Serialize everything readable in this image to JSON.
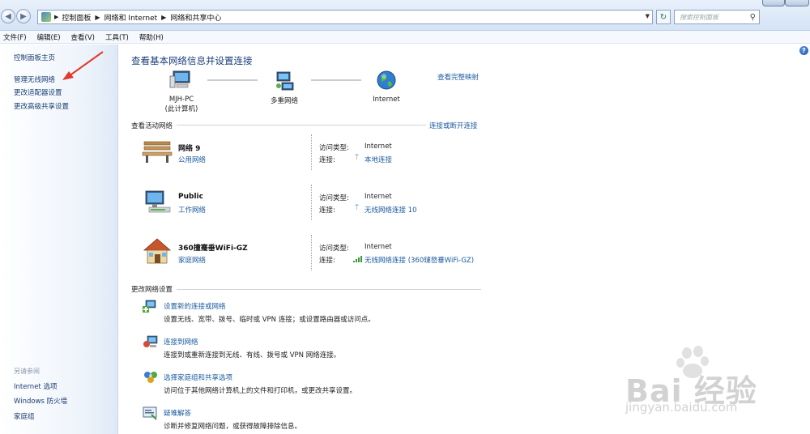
{
  "window": {
    "breadcrumb": [
      "控制面板",
      "网络和 Internet",
      "网络和共享中心"
    ],
    "search_placeholder": "搜索控制面板"
  },
  "menu": [
    "文件(F)",
    "编辑(E)",
    "查看(V)",
    "工具(T)",
    "帮助(H)"
  ],
  "sidebar": {
    "home": "控制面板主页",
    "links": [
      "管理无线网络",
      "更改适配器设置",
      "更改高级共享设置"
    ],
    "see_also_title": "另请参阅",
    "see_also": [
      "Internet 选项",
      "Windows 防火墙",
      "家庭组"
    ]
  },
  "main": {
    "title": "查看基本网络信息并设置连接",
    "full_map": "查看完整映射",
    "nodes": [
      {
        "name": "MJH-PC",
        "sub": "(此计算机)",
        "icon": "computer-icon"
      },
      {
        "name": "多重网络",
        "sub": "",
        "icon": "network-icon"
      },
      {
        "name": "Internet",
        "sub": "",
        "icon": "globe-icon"
      }
    ],
    "active_header": "查看活动网络",
    "connect_link": "连接或断开连接",
    "networks": [
      {
        "name": "网络  9",
        "type": "公用网络",
        "access_label": "访问类型:",
        "access": "Internet",
        "conn_label": "连接:",
        "conn": "本地连接",
        "icon": "bench-icon"
      },
      {
        "name": "Public",
        "type": "工作网络",
        "access_label": "访问类型:",
        "access": "Internet",
        "conn_label": "连接:",
        "conn": "无线网络连接 10",
        "icon": "office-icon"
      },
      {
        "name": "360撞蹇垂WiFi-GZ",
        "type": "家庭网络",
        "access_label": "访问类型:",
        "access": "Internet",
        "conn_label": "连接:",
        "conn": "无线网络连接 (360鏈嶅垂WiFi-GZ)",
        "icon": "house-icon"
      }
    ],
    "change_header": "更改网络设置",
    "tasks": [
      {
        "title": "设置新的连接或网络",
        "desc": "设置无线、宽带、拨号、临时或 VPN 连接；或设置路由器或访问点。",
        "icon": "new-connection-icon"
      },
      {
        "title": "连接到网络",
        "desc": "连接到或重新连接到无线、有线、拨号或 VPN 网络连接。",
        "icon": "connect-network-icon"
      },
      {
        "title": "选择家庭组和共享选项",
        "desc": "访问位于其他网络计算机上的文件和打印机，或更改共享设置。",
        "icon": "homegroup-icon"
      },
      {
        "title": "疑难解答",
        "desc": "诊断并修复网络问题，或获得故障排除信息。",
        "icon": "troubleshoot-icon"
      }
    ]
  },
  "watermark": {
    "brand": "Bai  经验",
    "url": "jingyan.baidu.com"
  }
}
